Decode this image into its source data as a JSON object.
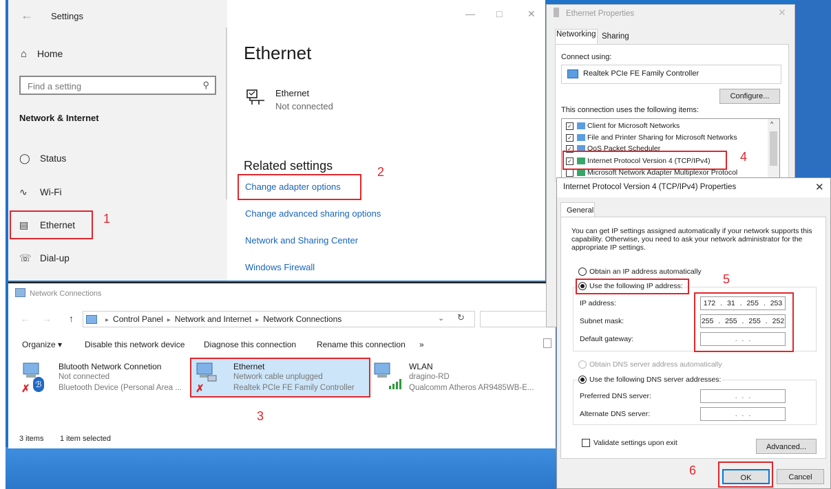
{
  "settings": {
    "title": "Settings",
    "home": "Home",
    "search_placeholder": "Find a setting",
    "category": "Network & Internet",
    "nav": [
      "Status",
      "Wi-Fi",
      "Ethernet",
      "Dial-up"
    ],
    "page_title": "Ethernet",
    "ethernet_name": "Ethernet",
    "ethernet_status": "Not connected",
    "related_title": "Related settings",
    "links": [
      "Change adapter options",
      "Change advanced sharing options",
      "Network and Sharing Center",
      "Windows Firewall"
    ]
  },
  "network_connections": {
    "title": "Network Connections",
    "breadcrumb": [
      "Control Panel",
      "Network and Internet",
      "Network Connections"
    ],
    "toolbar": [
      "Organize ▾",
      "Disable this network device",
      "Diagnose this connection",
      "Rename this connection",
      "»"
    ],
    "items": [
      {
        "name": "Blutooth Network Connetion",
        "status": "Not connected",
        "device": "Bluetooth Device (Personal Area ..."
      },
      {
        "name": "Ethernet",
        "status": "Network cable unplugged",
        "device": "Realtek PCIe FE Family Controller"
      },
      {
        "name": "WLAN",
        "status": "dragino-RD",
        "device": "Qualcomm Atheros AR9485WB-E..."
      }
    ],
    "status_count": "3 items",
    "status_selected": "1 item selected"
  },
  "ethernet_properties": {
    "title": "Ethernet Properties",
    "tabs": [
      "Networking",
      "Sharing"
    ],
    "connect_using": "Connect using:",
    "adapter": "Realtek PCIe FE Family Controller",
    "configure": "Configure...",
    "items_label": "This connection uses the following items:",
    "items": [
      "Client for Microsoft Networks",
      "File and Printer Sharing for Microsoft Networks",
      "QoS Packet Scheduler",
      "Internet Protocol Version 4 (TCP/IPv4)",
      "Microsoft Network Adapter Multiplexor Protocol"
    ]
  },
  "ipv4": {
    "title": "Internet Protocol Version 4 (TCP/IPv4) Properties",
    "tab": "General",
    "description": "You can get IP settings assigned automatically if your network supports this capability. Otherwise, you need to ask your network administrator for the appropriate IP settings.",
    "obtain_ip": "Obtain an IP address automatically",
    "use_ip": "Use the following IP address:",
    "ip_label": "IP address:",
    "ip_value": "172 . 31 . 255 . 253",
    "mask_label": "Subnet mask:",
    "mask_value": "255 . 255 . 255 . 252",
    "gateway_label": "Default gateway:",
    "gateway_value": ". . .",
    "obtain_dns": "Obtain DNS server address automatically",
    "use_dns": "Use the following DNS server addresses:",
    "pref_dns_label": "Preferred DNS server:",
    "pref_dns_value": ". . .",
    "alt_dns_label": "Alternate DNS server:",
    "alt_dns_value": ". . .",
    "validate": "Validate settings upon exit",
    "advanced": "Advanced...",
    "ok": "OK",
    "cancel": "Cancel"
  },
  "annotations": [
    "1",
    "2",
    "3",
    "4",
    "5",
    "6"
  ],
  "colors": {
    "annotation": "#e0262c",
    "link": "#1764b8",
    "desktop": "#1f73c9"
  }
}
